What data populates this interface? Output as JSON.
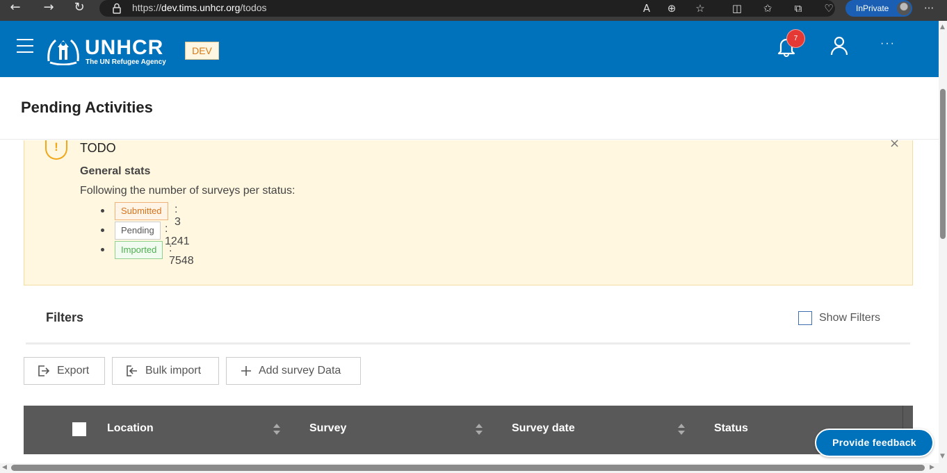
{
  "browser": {
    "url_prefix": "https://",
    "url_host": "dev.tims.unhcr.org",
    "url_path": "/todos",
    "inprivate_label": "InPrivate"
  },
  "header": {
    "logo_word": "UNHCR",
    "logo_tagline": "The UN Refugee Agency",
    "env_badge": "DEV",
    "notification_count": "7",
    "more_label": "···"
  },
  "page": {
    "title": "Pending Activities"
  },
  "alert": {
    "icon_glyph": "!",
    "title": "TODO",
    "close_glyph": "×",
    "heading": "General stats",
    "description": "Following the number of surveys per status:",
    "stats": [
      {
        "status": "Submitted",
        "count": ": 3"
      },
      {
        "status": "Pending",
        "count": ": 1241"
      },
      {
        "status": "Imported",
        "count": ": 7548"
      }
    ]
  },
  "filters": {
    "title": "Filters",
    "show_filters_label": "Show Filters"
  },
  "actions": {
    "export_label": "Export",
    "bulk_import_label": "Bulk import",
    "add_survey_label": "Add survey Data"
  },
  "table": {
    "columns": [
      "Location",
      "Survey",
      "Survey date",
      "Status"
    ]
  },
  "feedback": {
    "label": "Provide feedback"
  },
  "colors": {
    "brand_blue": "#0072bc",
    "alert_bg": "#fff7e0",
    "submitted": "#d8731c",
    "imported": "#4caf50",
    "badge_red": "#e53935"
  }
}
